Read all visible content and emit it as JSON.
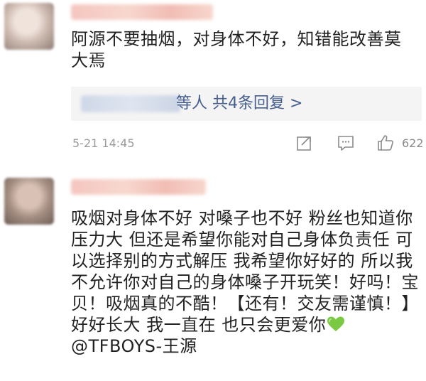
{
  "comments": [
    {
      "text": "阿源不要抽烟，对身体不好，知错能改善莫大焉",
      "reply_summary": "等人  共4条回复 >",
      "time": "5-21 14:45",
      "like_count": "622"
    },
    {
      "text": "吸烟对身体不好 对嗓子也不好 粉丝也知道你压力大 但还是希望你能对自己身体负责任 可以选择别的方式解压 我希望你好好的 所以我不允许你对自己的身体嗓子开玩笑！好吗！宝贝！吸烟真的不酷！【还有！交友需谨慎！】好好长大 我一直在 也只会更爱你",
      "emoji": "green-heart-icon",
      "mention": "@TFBOYS-王源"
    }
  ],
  "colors": {
    "text": "#222222",
    "link": "#465f8f",
    "meta": "#9b9b9b",
    "reply_bg": "#f4f4f4",
    "heart": "#7ac943"
  }
}
